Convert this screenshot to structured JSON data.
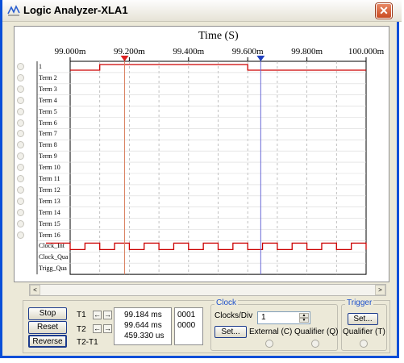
{
  "window": {
    "title": "Logic Analyzer-XLA1",
    "close_symbol": "✕"
  },
  "plot": {
    "axis_title": "Time (S)",
    "ticks": [
      "99.000m",
      "99.200m",
      "99.400m",
      "99.600m",
      "99.800m",
      "100.000m"
    ],
    "channels": [
      "1",
      "Term 2",
      "Term 3",
      "Term 4",
      "Term 5",
      "Term 6",
      "Term 7",
      "Term 8",
      "Term 9",
      "Term 10",
      "Term 11",
      "Term 12",
      "Term 13",
      "Term 14",
      "Term 15",
      "Term 16",
      "Clock_Int",
      "Clock_Qua",
      "Trigg_Qua"
    ],
    "trace_color": "#cc0000",
    "cursor1_color": "#d98060",
    "cursor2_color": "#6a6ad6",
    "cursor1_time_ms": 99.184,
    "cursor2_time_ms": 99.644
  },
  "scrollbar": {
    "left_arrow": "<",
    "right_arrow": ">"
  },
  "controls": {
    "stop_label": "Stop",
    "reset_label": "Reset",
    "reverse_label": "Reverse",
    "t1_label": "T1",
    "t2_label": "T2",
    "t2t1_label": "T2-T1",
    "arrow_left": "←",
    "arrow_right": "→",
    "t1_time": "99.184 ms",
    "t2_time": "99.644 ms",
    "delta_time": "459.330 us",
    "t1_value": "0001",
    "t2_value": "0000"
  },
  "clock": {
    "group_label": "Clock",
    "clocks_div_label": "Clocks/Div",
    "clocks_div_value": "1",
    "set_label": "Set...",
    "external_label": "External (C)",
    "qualifier_label": "Qualifier (Q)"
  },
  "trigger": {
    "group_label": "Trigger",
    "set_label": "Set...",
    "qualifier_label": "Qualifier (T)"
  }
}
